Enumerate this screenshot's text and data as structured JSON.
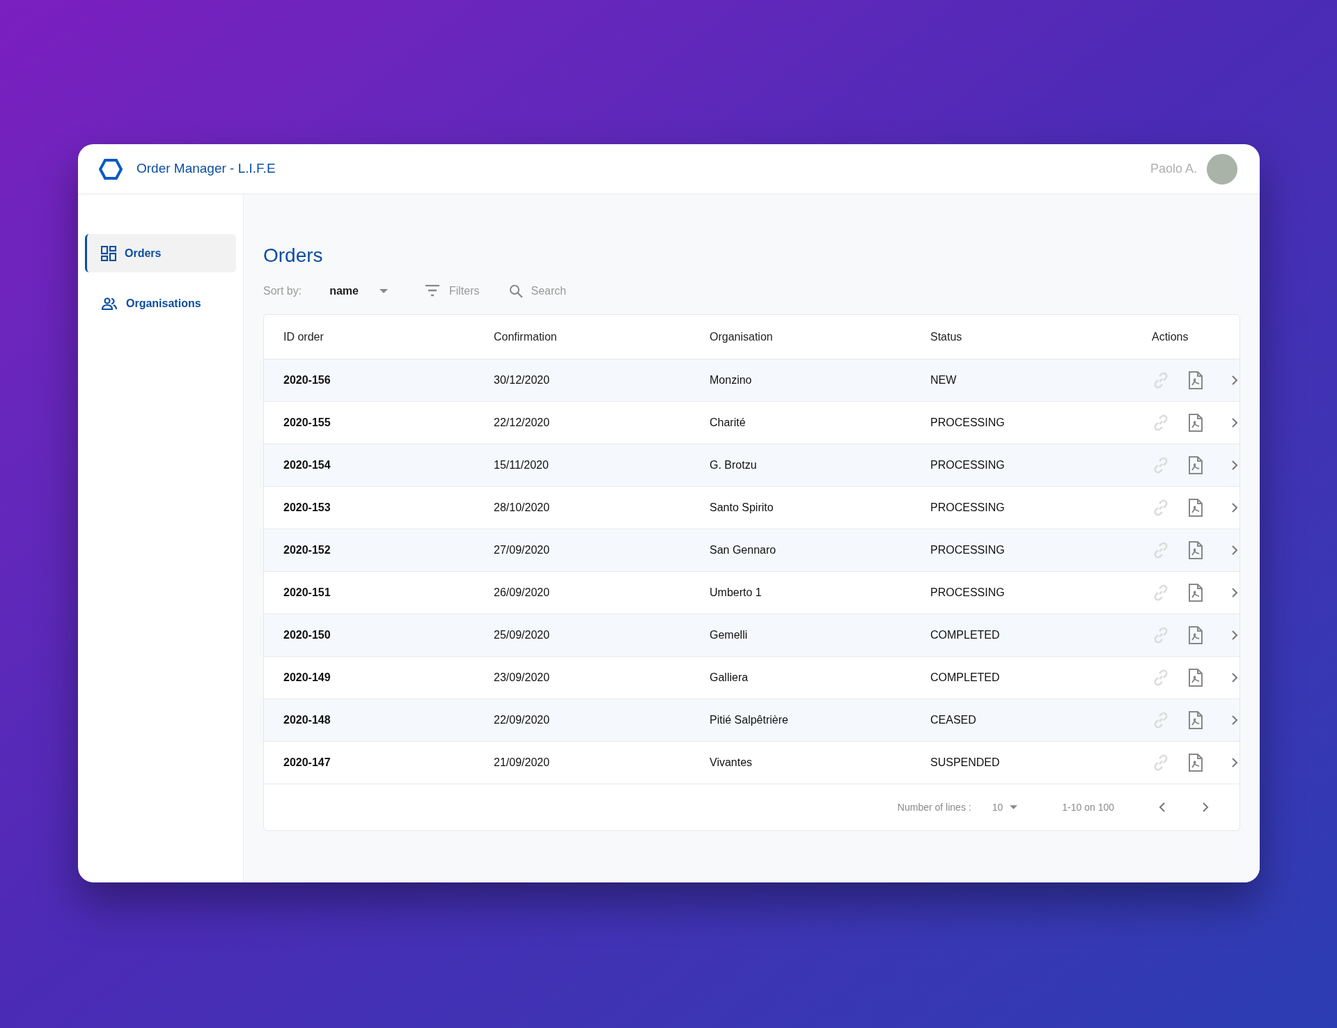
{
  "header": {
    "title": "Order Manager - L.I.F.E",
    "user": "Paolo A."
  },
  "sidebar": {
    "items": [
      {
        "label": "Orders",
        "kind": "grid",
        "selected": true
      },
      {
        "label": "Organisations",
        "kind": "people",
        "selected": false
      }
    ]
  },
  "page": {
    "title": "Orders"
  },
  "toolbar": {
    "sort_label": "Sort by:",
    "sort_value": "name",
    "filters": "Filters",
    "search": {
      "placeholder": "Search"
    }
  },
  "table": {
    "columns": [
      "ID order",
      "Confirmation",
      "Organisation",
      "Status",
      "Actions"
    ],
    "rows": [
      {
        "id": "2020-156",
        "confirmation": "30/12/2020",
        "organisation": "Monzino",
        "status": "NEW",
        "link_disabled": true
      },
      {
        "id": "2020-155",
        "confirmation": "22/12/2020",
        "organisation": "Charité",
        "status": "PROCESSING",
        "link_disabled": true
      },
      {
        "id": "2020-154",
        "confirmation": "15/11/2020",
        "organisation": "G. Brotzu",
        "status": "PROCESSING",
        "link_disabled": true
      },
      {
        "id": "2020-153",
        "confirmation": "28/10/2020",
        "organisation": "Santo Spirito",
        "status": "PROCESSING",
        "link_disabled": true
      },
      {
        "id": "2020-152",
        "confirmation": "27/09/2020",
        "organisation": "San Gennaro",
        "status": "PROCESSING",
        "link_disabled": true
      },
      {
        "id": "2020-151",
        "confirmation": "26/09/2020",
        "organisation": "Umberto 1",
        "status": "PROCESSING",
        "link_disabled": true
      },
      {
        "id": "2020-150",
        "confirmation": "25/09/2020",
        "organisation": "Gemelli",
        "status": "COMPLETED",
        "link_disabled": true
      },
      {
        "id": "2020-149",
        "confirmation": "23/09/2020",
        "organisation": "Galliera",
        "status": "COMPLETED",
        "link_disabled": true
      },
      {
        "id": "2020-148",
        "confirmation": "22/09/2020",
        "organisation": "Pitié Salpêtrière",
        "status": "CEASED",
        "link_disabled": true
      },
      {
        "id": "2020-147",
        "confirmation": "21/09/2020",
        "organisation": "Vivantes",
        "status": "SUSPENDED",
        "link_disabled": true
      }
    ]
  },
  "pagination": {
    "lines_label": "Number of lines :",
    "lines_value": "10",
    "range": "1-10 on 100"
  }
}
